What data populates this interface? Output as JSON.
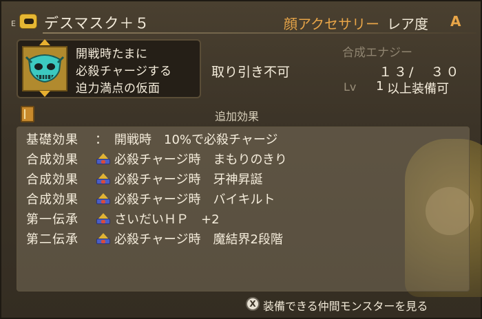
{
  "header": {
    "equip_mark": "E",
    "item_name": "デスマスク＋５",
    "category": "顔アクセサリー",
    "rarity_label": "レア度",
    "rarity": "A"
  },
  "description": {
    "lines": [
      "開戦時たまに",
      "必殺チャージする",
      "迫力満点の仮面"
    ]
  },
  "info": {
    "trade": "取り引き不可",
    "synthesis_label": "合成エナジー",
    "synthesis_value": "１３/　３０",
    "lv_label": "Lv",
    "lv_num": "1",
    "lv_suffix": "以上装備可"
  },
  "effects": {
    "title": "追加効果",
    "rows": [
      {
        "label": "基礎効果",
        "sep": "：",
        "text": "開戦時　10%で必殺チャージ",
        "crown": false
      },
      {
        "label": "合成効果",
        "sep": "",
        "text": "必殺チャージ時　まもりのきり",
        "crown": true
      },
      {
        "label": "合成効果",
        "sep": "",
        "text": "必殺チャージ時　牙神昇誕",
        "crown": true
      },
      {
        "label": "合成効果",
        "sep": "",
        "text": "必殺チャージ時　バイキルト",
        "crown": true
      },
      {
        "label": "第一伝承",
        "sep": "",
        "text": "さいだいＨＰ　+2",
        "crown": true
      },
      {
        "label": "第二伝承",
        "sep": "",
        "text": "必殺チャージ時　魔結界2段階",
        "crown": true
      }
    ]
  },
  "footer": {
    "button_glyph": "X",
    "text": "装備できる仲間モンスターを見る"
  },
  "colors": {
    "accent_orange": "#e8a548",
    "crown_blue": "#4b5ec4",
    "crown_gold": "#e0b334"
  }
}
